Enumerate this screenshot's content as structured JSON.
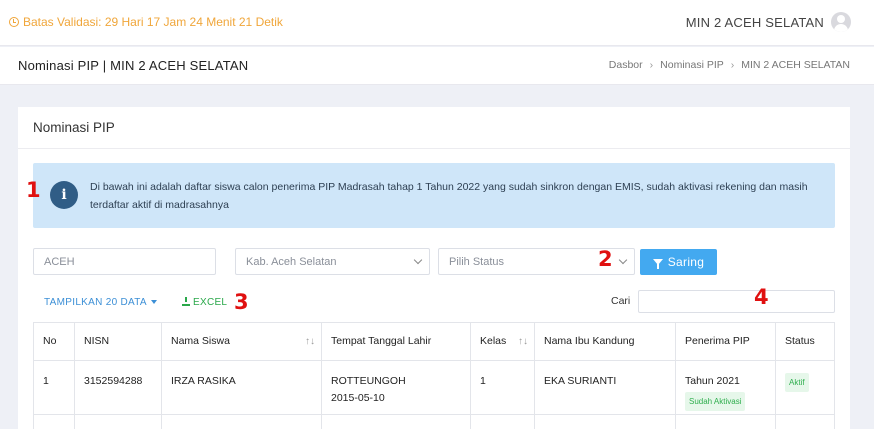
{
  "topbar": {
    "validity_text": "Batas Validasi: 29 Hari 17 Jam 24 Menit 21 Detik",
    "school_name": "MIN 2 ACEH SELATAN"
  },
  "subheader": {
    "title": "Nominasi PIP | MIN 2 ACEH SELATAN",
    "breadcrumb": [
      "Dasbor",
      "Nominasi PIP",
      "MIN 2 ACEH SELATAN"
    ]
  },
  "card": {
    "title": "Nominasi PIP",
    "alert_text": "Di bawah ini adalah daftar siswa calon penerima PIP Madrasah tahap 1 Tahun 2022 yang sudah sinkron dengan EMIS, sudah aktivasi rekening dan masih terdaftar aktif di madrasahnya"
  },
  "annotations": [
    "1",
    "2",
    "3",
    "4"
  ],
  "filters": {
    "province_value": "ACEH",
    "regency_value": "Kab. Aceh Selatan",
    "status_placeholder": "Pilih Status",
    "filter_label": "Saring"
  },
  "toolbar": {
    "show_label": "TAMPILKAN 20 DATA",
    "excel_label": "EXCEL",
    "search_label": "Cari"
  },
  "table": {
    "headers": [
      "No",
      "NISN",
      "Nama Siswa",
      "Tempat Tanggal Lahir",
      "Kelas",
      "Nama Ibu Kandung",
      "Penerima PIP",
      "Status"
    ],
    "rows": [
      {
        "no": "1",
        "nisn": "3152594288",
        "name": "IRZA RASIKA",
        "birth_place": "ROTTEUNGOH",
        "birth_date": "2015-05-10",
        "class": "1",
        "mother": "EKA SURIANTI",
        "pip_year": "Tahun 2021",
        "activation": "Sudah Aktivasi",
        "status": "Aktif"
      }
    ]
  },
  "colors": {
    "accent": "#43a9f0",
    "warning": "#f0a63a",
    "success": "#2fae4e",
    "alert_bg": "#cfe6f9",
    "annotation": "#e01010"
  }
}
